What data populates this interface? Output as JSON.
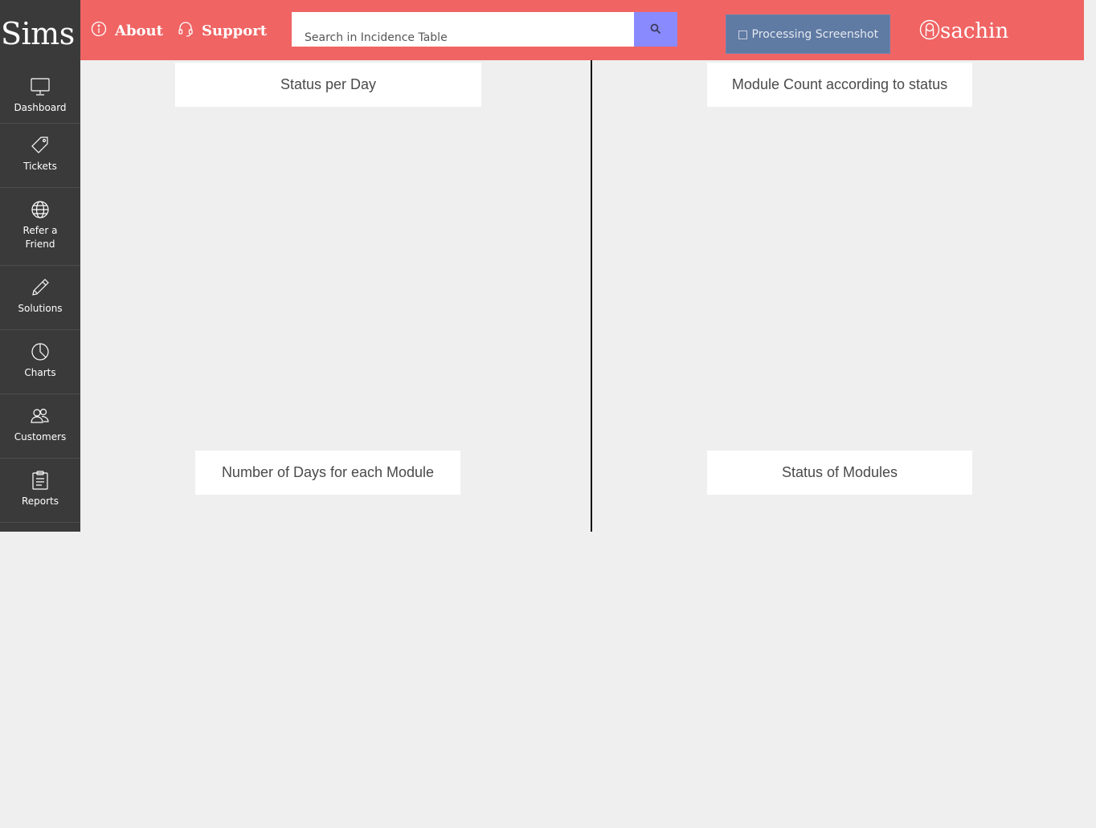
{
  "app": {
    "logo": "Sims"
  },
  "sidebar": {
    "items": [
      {
        "label": "Dashboard",
        "icon": "monitor-icon"
      },
      {
        "label": "Tickets",
        "icon": "tag-icon"
      },
      {
        "label": "Refer a Friend",
        "icon": "globe-icon"
      },
      {
        "label": "Solutions",
        "icon": "pencil-icon"
      },
      {
        "label": "Charts",
        "icon": "pie-chart-icon"
      },
      {
        "label": "Customers",
        "icon": "users-icon"
      },
      {
        "label": "Reports",
        "icon": "clipboard-icon"
      }
    ]
  },
  "header": {
    "about_label": "About",
    "support_label": "Support",
    "search": {
      "placeholder": "Search in Incidence Table",
      "value": ""
    },
    "processing_label": "□ Processing Screenshot",
    "user_name": "sachin"
  },
  "charts": {
    "status_per_day": "Status per Day",
    "module_count": "Module Count according to status",
    "days_per_module": "Number of Days for each Module",
    "status_of_modules": "Status of Modules"
  },
  "colors": {
    "header_bg": "#f06464",
    "sidebar_bg": "#3a3a3a",
    "search_button": "#8a8aff",
    "processing_button": "#5f7aa3",
    "page_bg": "#efefef"
  }
}
